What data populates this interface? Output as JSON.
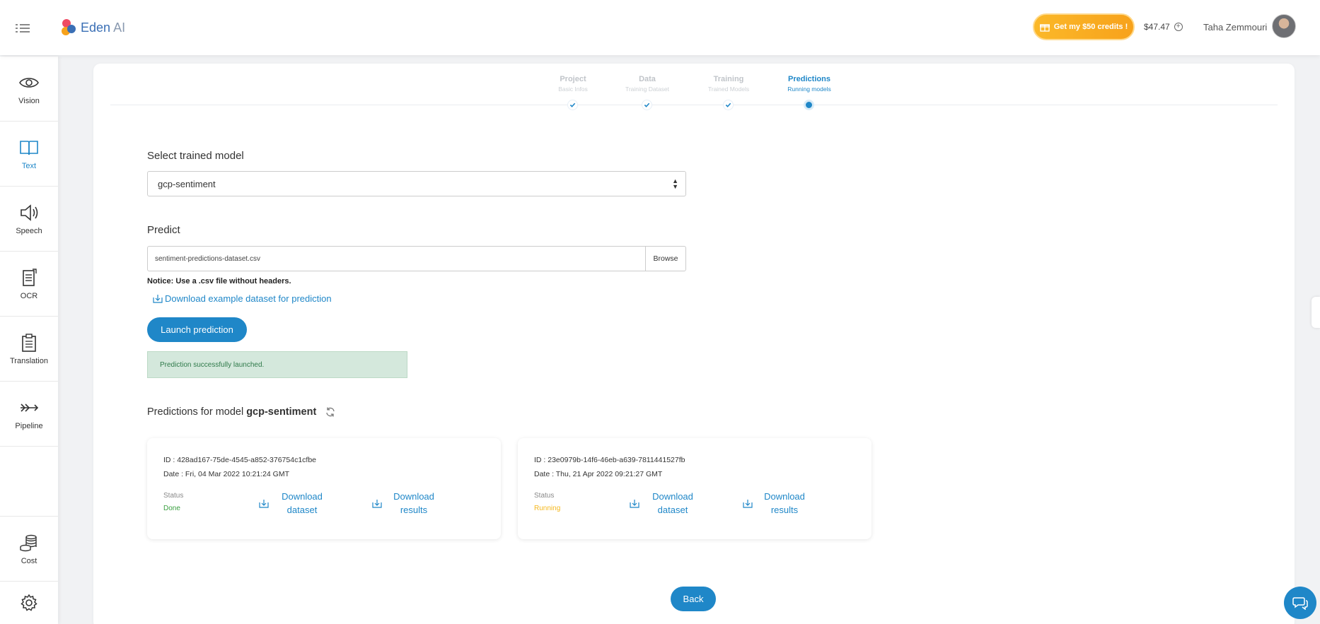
{
  "app": {
    "logo_text": "Eden",
    "logo_suffix": "AI"
  },
  "header": {
    "credits_button": "Get my $50 credits !",
    "balance": "$47.47",
    "username": "Taha Zemmouri"
  },
  "sidebar": {
    "items": [
      {
        "label": "Vision",
        "icon": "eye-icon"
      },
      {
        "label": "Text",
        "icon": "book-icon"
      },
      {
        "label": "Speech",
        "icon": "speaker-icon"
      },
      {
        "label": "OCR",
        "icon": "document-icon"
      },
      {
        "label": "Translation",
        "icon": "clipboard-icon"
      },
      {
        "label": "Pipeline",
        "icon": "pipeline-icon"
      }
    ],
    "cost_label": "Cost",
    "active_item": "Text"
  },
  "stepper": {
    "steps": [
      {
        "title": "Project",
        "subtitle": "Basic Infos",
        "state": "done"
      },
      {
        "title": "Data",
        "subtitle": "Training Dataset",
        "state": "done"
      },
      {
        "title": "Training",
        "subtitle": "Trained Models",
        "state": "done"
      },
      {
        "title": "Predictions",
        "subtitle": "Running models",
        "state": "current"
      }
    ]
  },
  "form": {
    "select_label": "Select trained model",
    "selected_model": "gcp-sentiment",
    "predict_label": "Predict",
    "file_value": "sentiment-predictions-dataset.csv",
    "browse_label": "Browse",
    "notice": "Notice: Use a .csv file without headers.",
    "download_example": "Download example dataset for prediction",
    "launch_button": "Launch prediction",
    "success_message": "Prediction successfully launched."
  },
  "predictions": {
    "title_prefix": "Predictions for model",
    "model_name": "gcp-sentiment",
    "status_label": "Status",
    "download_dataset": "Download dataset",
    "download_results": "Download results",
    "items": [
      {
        "id": "ID : 428ad167-75de-4545-a852-376754c1cfbe",
        "date": "Date : Fri, 04 Mar 2022 10:21:24 GMT",
        "status": "Done"
      },
      {
        "id": "ID : 23e0979b-14f6-46eb-a639-7811441527fb",
        "date": "Date : Thu, 21 Apr 2022 09:21:27 GMT",
        "status": "Running"
      }
    ]
  },
  "footer": {
    "back_button": "Back"
  },
  "colors": {
    "accent": "#1f87c8",
    "credits": "#fbb829",
    "done": "#3aa041",
    "running": "#f5b81e",
    "success_bg": "#d4e8dc"
  }
}
